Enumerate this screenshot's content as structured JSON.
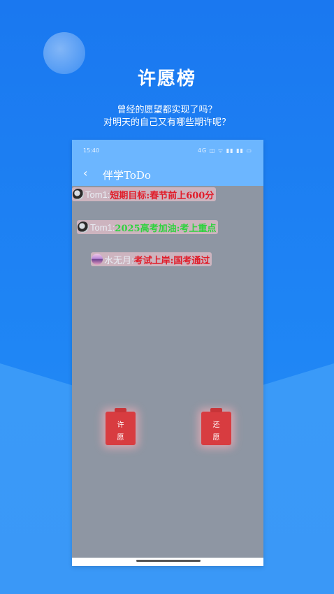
{
  "header": {
    "title": "许愿榜",
    "subtitle_line1": "曾经的愿望都实现了吗？",
    "subtitle_line2": "对明天的自己又有哪些期许呢？"
  },
  "phone": {
    "status_time": "15:40",
    "status_icons": "4G ◫ ᯤ ▮▮ ▮▮ ▭",
    "app_title": "伴学ToDo",
    "back_glyph": "‹"
  },
  "wishes": [
    {
      "user": "Tom1:",
      "text": "短期目标:春节前上600分",
      "color": "#e11d2a"
    },
    {
      "user": "Tom1:",
      "text": "2025高考加油:考上重点",
      "color": "#2fd23f"
    },
    {
      "user": "水无月:",
      "text": "考试上岸:国考通过",
      "color": "#e11d2a"
    }
  ],
  "buttons": {
    "make_wish_top": "许",
    "make_wish_bottom": "愿",
    "fulfill_wish_top": "还",
    "fulfill_wish_bottom": "愿"
  }
}
